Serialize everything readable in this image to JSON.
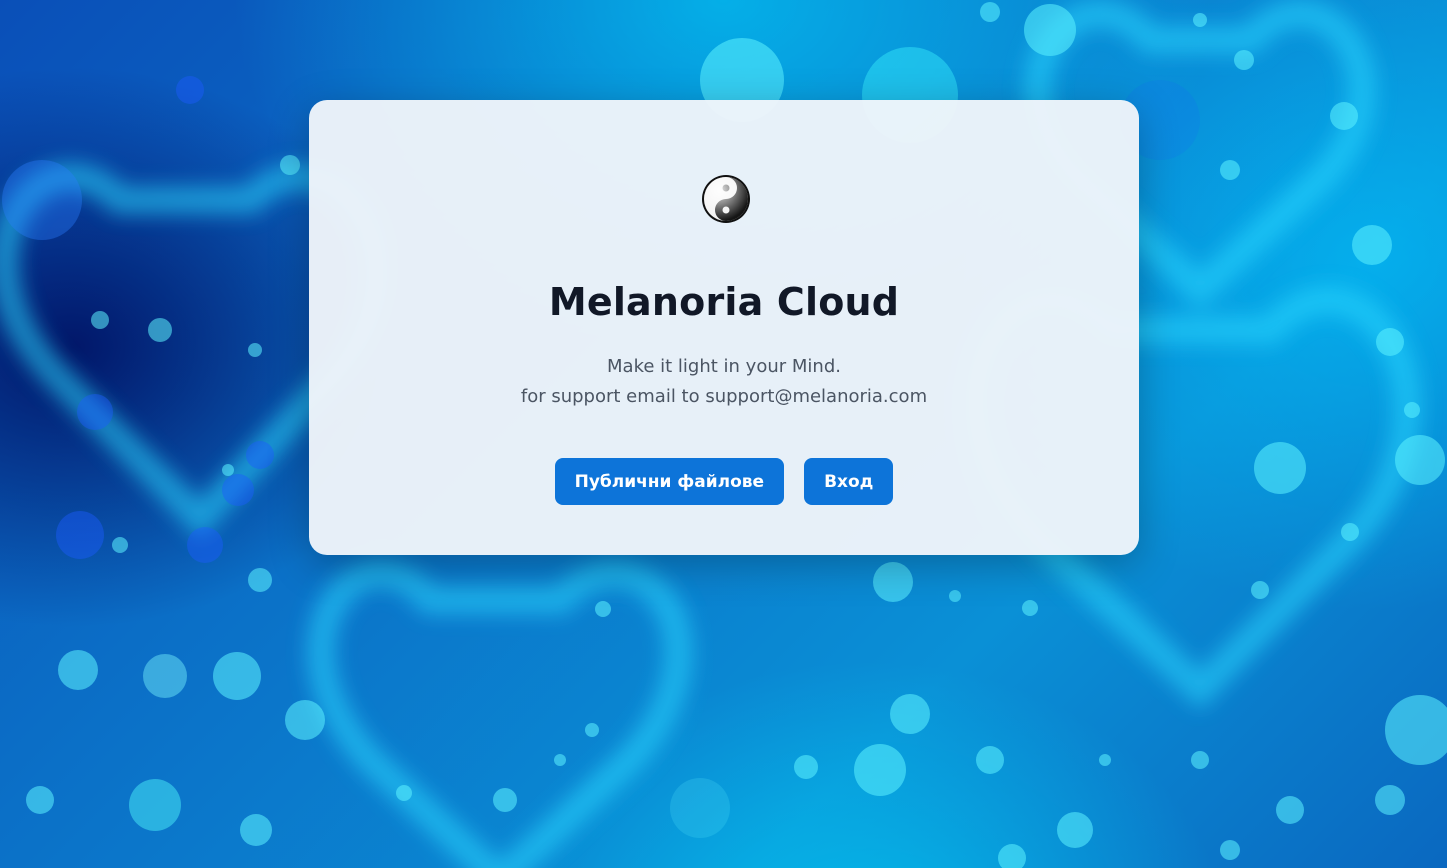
{
  "app": {
    "title": "Melanoria Cloud",
    "tagline": "Make it light in your Mind.",
    "support_text": "for support email to support@melanoria.com"
  },
  "logo": {
    "icon": "yin-yang-icon"
  },
  "actions": {
    "public_files_label": "Публични файлове",
    "login_label": "Вход"
  },
  "colors": {
    "accent": "#0d74d9",
    "title": "#111827",
    "subtitle": "#4b5563",
    "card_bg": "#eef3f8"
  }
}
